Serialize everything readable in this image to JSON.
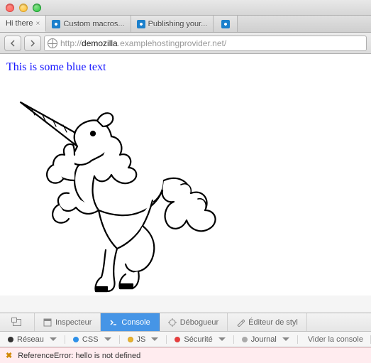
{
  "tabs": [
    {
      "label": "Hi there",
      "active": true,
      "has_favicon": false,
      "closable": true
    },
    {
      "label": "Custom macros...",
      "active": false,
      "has_favicon": true,
      "closable": false
    },
    {
      "label": "Publishing your...",
      "active": false,
      "has_favicon": true,
      "closable": false
    },
    {
      "label": "",
      "active": false,
      "has_favicon": true,
      "closable": false
    }
  ],
  "url": {
    "protocol": "http://",
    "host_prefix": "demozilla",
    "host_suffix": ".examplehostingprovider.net",
    "path": "/"
  },
  "page": {
    "text": "This is some blue text"
  },
  "devtools": {
    "tabs": {
      "inspector": "Inspecteur",
      "console": "Console",
      "debugger": "Débogueur",
      "style_editor": "Éditeur de styl"
    },
    "filters": {
      "network": "Réseau",
      "css": "CSS",
      "js": "JS",
      "security": "Sécurité",
      "logging": "Journal",
      "clear": "Vider la console"
    },
    "error": "ReferenceError: hello is not defined"
  }
}
